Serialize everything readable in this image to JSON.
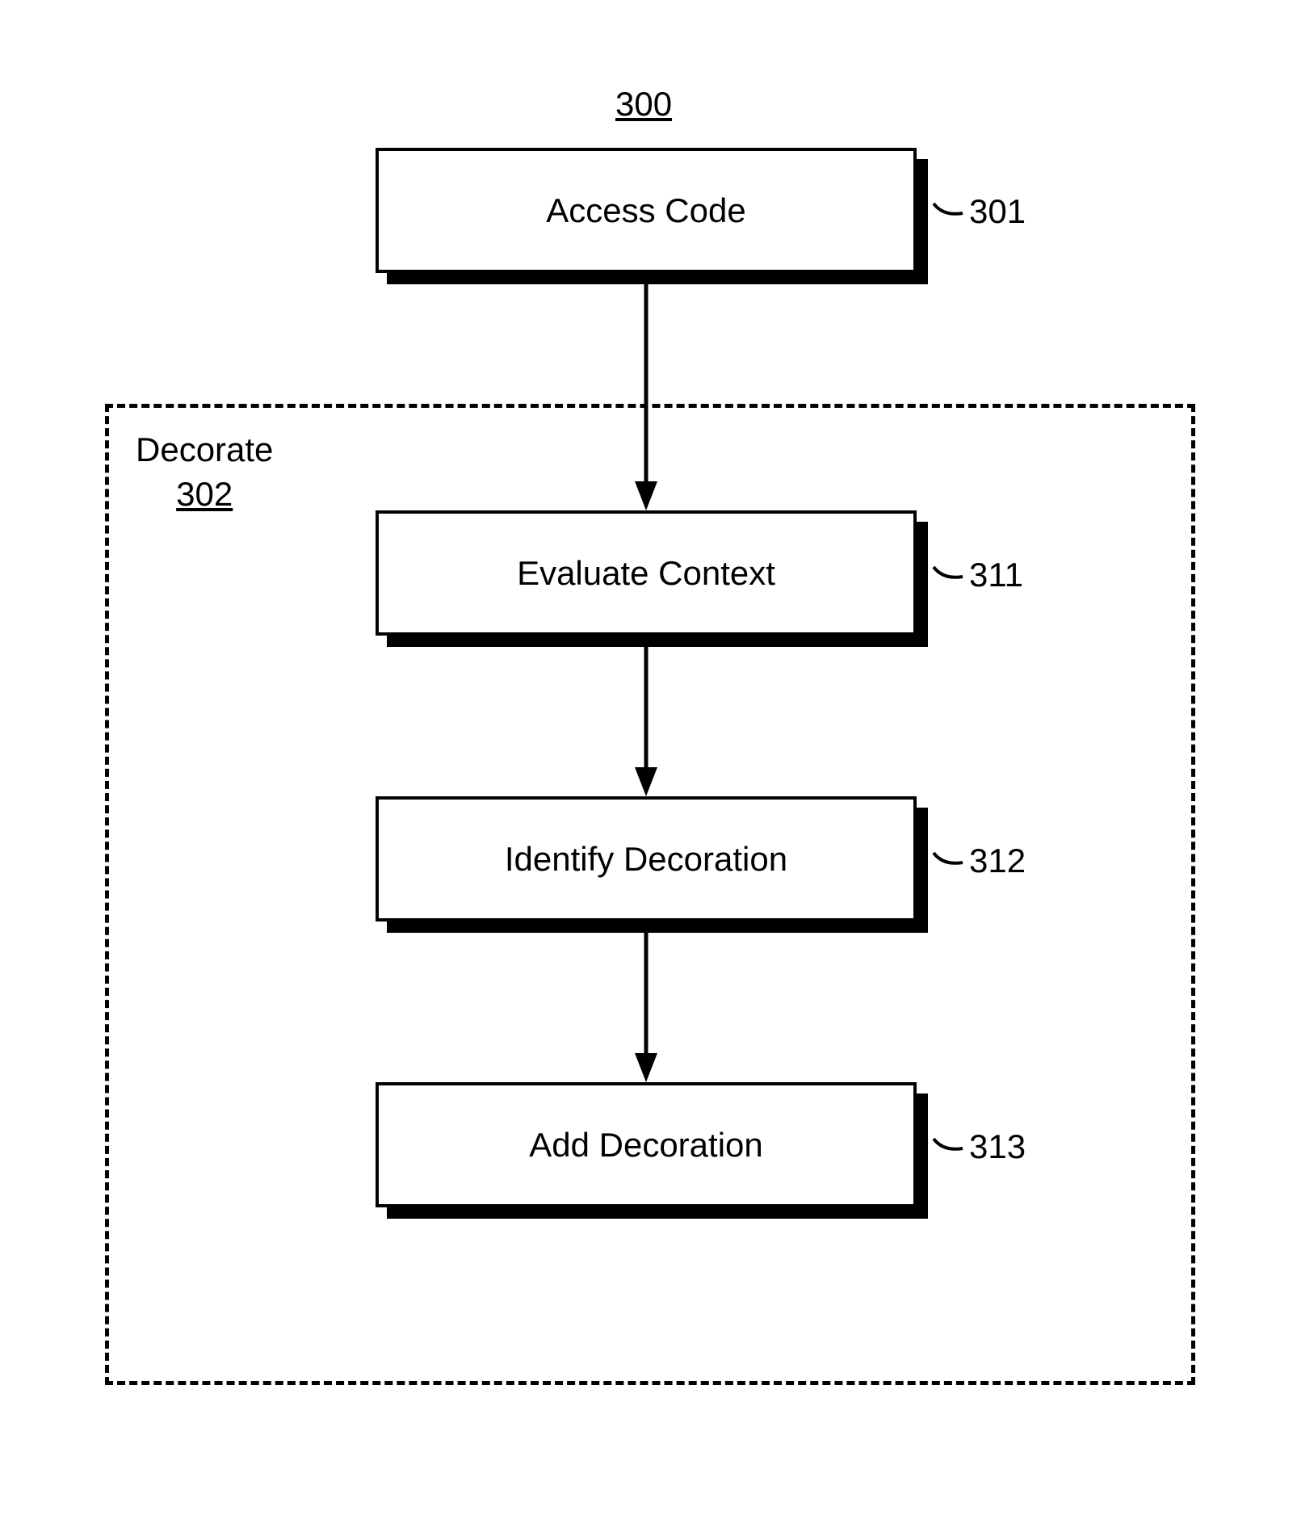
{
  "diagram": {
    "title": "300",
    "group": {
      "label": "Decorate",
      "ref": "302"
    },
    "boxes": {
      "access_code": {
        "text": "Access Code",
        "ref": "301"
      },
      "evaluate_context": {
        "text": "Evaluate Context",
        "ref": "311"
      },
      "identify_decoration": {
        "text": "Identify Decoration",
        "ref": "312"
      },
      "add_decoration": {
        "text": "Add Decoration",
        "ref": "313"
      }
    }
  }
}
